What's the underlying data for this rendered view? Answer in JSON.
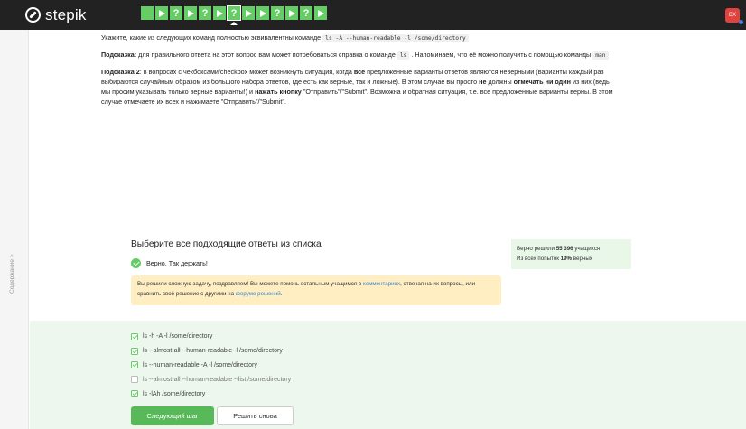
{
  "header": {
    "brand": "stepik",
    "steps": [
      {
        "kind": "square"
      },
      {
        "kind": "play"
      },
      {
        "kind": "q",
        "label": "?"
      },
      {
        "kind": "play"
      },
      {
        "kind": "q",
        "label": "?"
      },
      {
        "kind": "play"
      },
      {
        "kind": "current",
        "label": "?"
      },
      {
        "kind": "play"
      },
      {
        "kind": "play"
      },
      {
        "kind": "q",
        "label": "?"
      },
      {
        "kind": "play"
      },
      {
        "kind": "q",
        "label": "?"
      },
      {
        "kind": "play"
      }
    ],
    "avatar_initials": "BX",
    "accent": "#66cc66"
  },
  "sidebar": {
    "toggle_label": "Содержание"
  },
  "question": {
    "intro": "Укажите, какие из следующих команд полностью эквивалентны команде",
    "command": "ls -A --human-readable -l /some/directory",
    "hint1_label": "Подсказка:",
    "hint1_text": "для правильного ответа на этот вопрос вам может потребоваться справка о команде",
    "hint1_cmd": "ls",
    "hint1_tail": ". Напоминаем, что её можно получить с помощью команды",
    "hint1_cmd2": "man",
    "hint2_label": "Подсказка 2",
    "hint2_a": ": в вопросах с чекбоксами/checkbox может возникнуть ситуация, когда",
    "hint2_b": "все",
    "hint2_c": "предложенные варианты ответов являются неверными (варианты каждый раз выбираются случайным образом из большого набора ответов, где есть как верные, так и ложные). В этом случае вы просто",
    "hint2_d": "не",
    "hint2_e": "должны",
    "hint2_f": "отмечать ни один",
    "hint2_g": "из них (ведь мы просим указывать только верные варианты!) и",
    "hint2_h": "нажать кнопку",
    "hint2_i": "\"Отправить\"/\"Submit\". Возможна и обратная ситуация, т.е. все предложенные варианты верны. В этом случае отмечаете их всех и нажимаете \"Отправить\"/\"Submit\"."
  },
  "answers": {
    "title": "Выберите все подходящие ответы из списка",
    "verdict": "Верно. Так держать!",
    "stats_line1_a": "Верно решили",
    "stats_line1_b": "55 396",
    "stats_line1_c": "учащихся",
    "stats_line2_a": "Из всех попыток",
    "stats_line2_b": "19%",
    "stats_line2_c": "верных",
    "notice_a": "Вы решили сложную задачу, поздравляем! Вы можете помочь остальным учащимся в",
    "notice_link1": "комментариях",
    "notice_b": ", отвечая на их вопросы, или сравнить своё решение с другими на",
    "notice_link2": "форуме решений",
    "notice_c": ".",
    "options": [
      {
        "label": "ls -h -A -l /some/directory",
        "checked": true
      },
      {
        "label": "ls --almost-all --human-readable -l /some/directory",
        "checked": true
      },
      {
        "label": "ls --human-readable -A  -l /some/directory",
        "checked": true
      },
      {
        "label": "ls --almost-all --human-readable --list /some/directory",
        "checked": false
      },
      {
        "label": "ls -lAh /some/directory",
        "checked": true
      }
    ],
    "next_button": "Следующий шаг",
    "retry_button": "Решить снова"
  }
}
